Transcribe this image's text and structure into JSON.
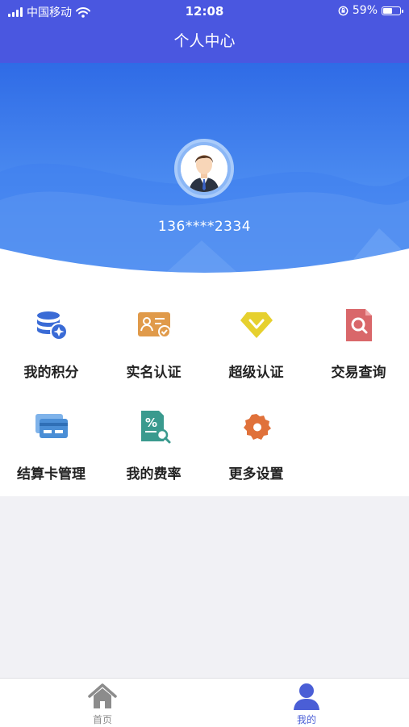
{
  "status_bar": {
    "carrier": "中国移动",
    "time": "12:08",
    "battery": "59%",
    "battery_level": 0.59
  },
  "nav": {
    "title": "个人中心"
  },
  "profile": {
    "phone": "136****2334"
  },
  "menu": {
    "items": [
      {
        "label": "我的积分",
        "icon": "points-coins-icon",
        "color": "#3a6bd6"
      },
      {
        "label": "实名认证",
        "icon": "id-card-verified-icon",
        "color": "#e09a4a"
      },
      {
        "label": "超级认证",
        "icon": "diamond-check-icon",
        "color": "#e6d02e"
      },
      {
        "label": "交易查询",
        "icon": "document-search-icon",
        "color": "#d9676a"
      },
      {
        "label": "结算卡管理",
        "icon": "bank-card-icon",
        "color": "#4a8ed6"
      },
      {
        "label": "我的费率",
        "icon": "rate-percent-doc-icon",
        "color": "#3a9a8e"
      },
      {
        "label": "更多设置",
        "icon": "gear-icon",
        "color": "#e0713a"
      }
    ]
  },
  "tabbar": {
    "tabs": [
      {
        "label": "首页",
        "icon": "home-icon",
        "active": false
      },
      {
        "label": "我的",
        "icon": "user-icon",
        "active": true
      }
    ],
    "active_color": "#4a5ed6",
    "inactive_color": "#8c8c8c"
  }
}
